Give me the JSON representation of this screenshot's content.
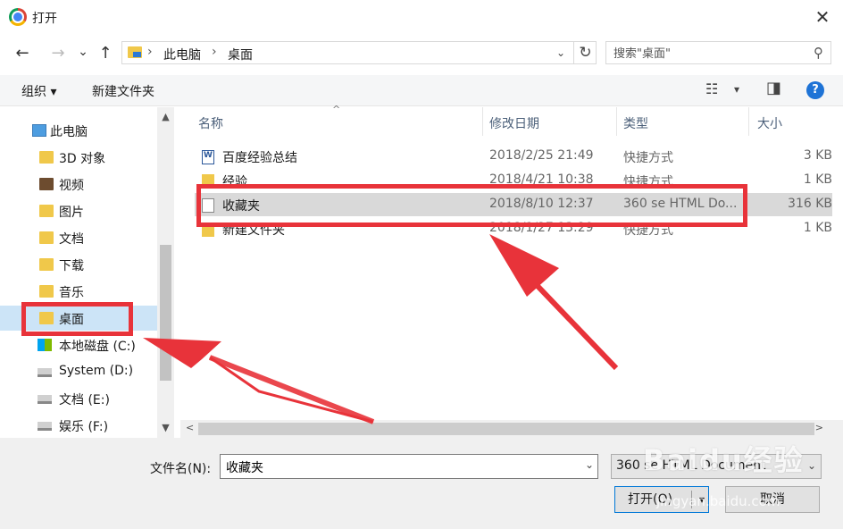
{
  "window": {
    "title": "打开",
    "close_glyph": "✕"
  },
  "nav": {
    "back_glyph": "←",
    "forward_glyph": "→",
    "recent_glyph": "⌄",
    "up_glyph": "↑",
    "breadcrumb": [
      "此电脑",
      "桌面"
    ],
    "crumb_sep": "›",
    "dropdown_glyph": "⌄",
    "refresh_glyph": "↻"
  },
  "search": {
    "placeholder": "搜索\"桌面\"",
    "icon_glyph": "⚲"
  },
  "toolbar": {
    "organize_label": "组织 ▾",
    "new_folder_label": "新建文件夹",
    "view_glyph": "☷",
    "view_dd_glyph": "▾",
    "pane_glyph": "◨",
    "help_glyph": "?"
  },
  "sidebar": {
    "items": [
      {
        "label": "此电脑",
        "icon": "pc-icon"
      },
      {
        "label": "3D 对象",
        "icon": "folder-3d-icon"
      },
      {
        "label": "视频",
        "icon": "video-folder-icon"
      },
      {
        "label": "图片",
        "icon": "pictures-folder-icon"
      },
      {
        "label": "文档",
        "icon": "documents-folder-icon"
      },
      {
        "label": "下载",
        "icon": "downloads-folder-icon"
      },
      {
        "label": "音乐",
        "icon": "music-folder-icon"
      },
      {
        "label": "桌面",
        "icon": "desktop-folder-icon"
      },
      {
        "label": "本地磁盘 (C:)",
        "icon": "windows-drive-icon"
      },
      {
        "label": "System (D:)",
        "icon": "drive-icon"
      },
      {
        "label": "文档 (E:)",
        "icon": "drive-icon"
      },
      {
        "label": "娱乐 (F:)",
        "icon": "drive-icon"
      }
    ],
    "selected": "桌面",
    "scroll_up_glyph": "▲",
    "scroll_down_glyph": "▼"
  },
  "columns": {
    "name": "名称",
    "modified": "修改日期",
    "type": "类型",
    "size": "大小",
    "sort_glyph": "^"
  },
  "files": [
    {
      "name": "百度经验总结",
      "modified": "2018/2/25 21:49",
      "type": "快捷方式",
      "size": "3 KB",
      "icon": "word-shortcut-icon"
    },
    {
      "name": "经验",
      "modified": "2018/4/21 10:38",
      "type": "快捷方式",
      "size": "1 KB",
      "icon": "folder-shortcut-icon"
    },
    {
      "name": "收藏夹",
      "modified": "2018/8/10 12:37",
      "type": "360 se HTML Do...",
      "size": "316 KB",
      "icon": "html-document-icon"
    },
    {
      "name": "新建文件夹",
      "modified": "2018/1/27 13:29",
      "type": "快捷方式",
      "size": "1 KB",
      "icon": "folder-shortcut-icon"
    }
  ],
  "selected_file": "收藏夹",
  "hscroll": {
    "left_glyph": "<",
    "right_glyph": ">"
  },
  "footer": {
    "filename_label": "文件名(N):",
    "filename_value": "收藏夹",
    "filename_dd_glyph": "⌄",
    "filetype_value": "360 se HTML Document",
    "filetype_dd_glyph": "⌄",
    "open_label": "打开(O)",
    "open_dd_glyph": "▾",
    "cancel_label": "取消"
  },
  "watermark": {
    "text": "Baidu经验",
    "url": "jingyan.baidu.com"
  },
  "colors": {
    "annotation_red": "#e8333a",
    "selection_blue": "#cce4f7",
    "accent_blue": "#0078d7"
  }
}
